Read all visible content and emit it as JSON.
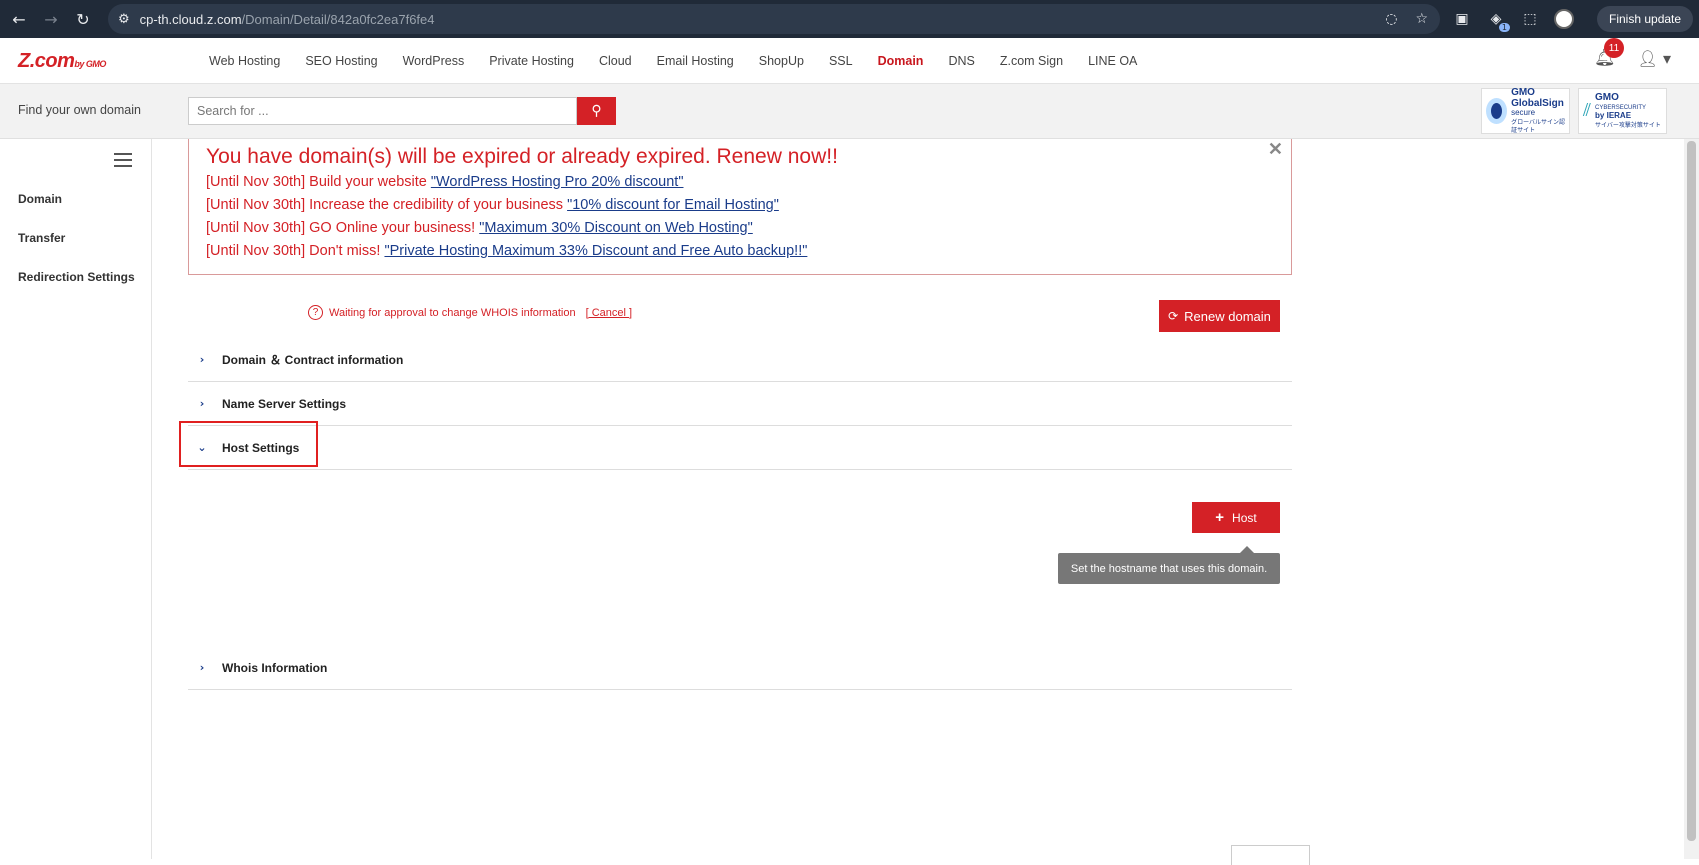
{
  "browser": {
    "url_host": "cp-th.cloud.z.com",
    "url_path": "/Domain/Detail/842a0fc2ea7f6fe4",
    "finish_update": "Finish update",
    "ext_badge": "1"
  },
  "header": {
    "logo": "Z.com",
    "logo_sub": "by GMO",
    "nav": [
      "Web Hosting",
      "SEO Hosting",
      "WordPress",
      "Private Hosting",
      "Cloud",
      "Email Hosting",
      "ShopUp",
      "SSL",
      "Domain",
      "DNS",
      "Z.com Sign",
      "LINE OA"
    ],
    "active_nav": "Domain",
    "notification_count": "11"
  },
  "search": {
    "label": "Find your own domain",
    "placeholder": "Search for ..."
  },
  "seals": {
    "globalsign": {
      "brand": "GMO",
      "name": "GlobalSign",
      "tag": "secure",
      "jp": "グローバルサイン認証サイト"
    },
    "cybersecurity": {
      "brand": "GMO",
      "name": "CYBERSECURITY",
      "by": "by IERAE",
      "jp": "サイバー攻撃対策サイト"
    }
  },
  "sidebar": {
    "items": [
      "Domain",
      "Transfer",
      "Redirection Settings"
    ]
  },
  "alert": {
    "title": "You have domain(s) will be expired or already expired. Renew now!!",
    "promos": [
      {
        "prefix": "[Until Nov 30th] Build your website ",
        "link": "\"WordPress Hosting Pro 20% discount\""
      },
      {
        "prefix": "[Until Nov 30th] Increase the credibility of your business ",
        "link": "\"10% discount for Email Hosting\""
      },
      {
        "prefix": "[Until Nov 30th] GO Online your business! ",
        "link": "\"Maximum 30% Discount on Web Hosting\""
      },
      {
        "prefix": "[Until Nov 30th] Don't miss! ",
        "link": "\"Private Hosting Maximum 33% Discount and Free Auto backup!!\""
      }
    ]
  },
  "status": {
    "text": "Waiting for approval to change WHOIS information",
    "cancel": "[ Cancel ]"
  },
  "renew_button": "Renew domain",
  "sections": [
    "Domain ＆ Contract information",
    "Name Server Settings",
    "Host Settings",
    "Whois Information"
  ],
  "host_button": "Host",
  "tooltip": "Set the hostname that uses this domain.",
  "colors": {
    "brand_red": "#d42126",
    "link_blue": "#1a3c8a"
  }
}
